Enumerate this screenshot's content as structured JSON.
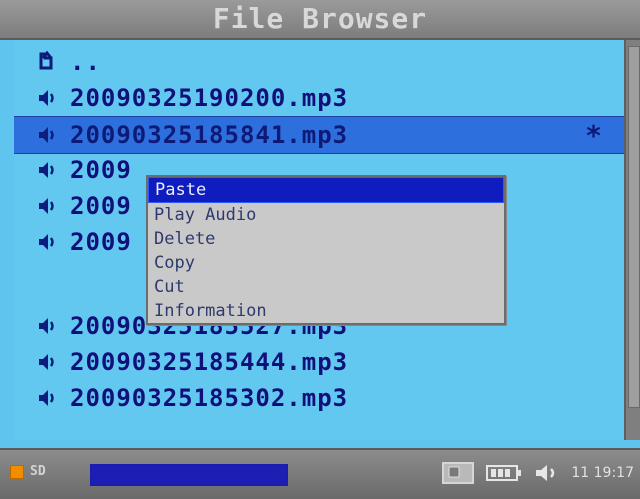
{
  "title": "File Browser",
  "file_list": [
    {
      "name": "..",
      "icon": "folder-up-icon"
    },
    {
      "name": "20090325190200.mp3",
      "icon": "speaker-icon"
    },
    {
      "name": "20090325185841.mp3",
      "icon": "speaker-icon",
      "selected": true,
      "mark": "*"
    },
    {
      "name": "2009",
      "icon": "speaker-icon"
    },
    {
      "name": "2009",
      "icon": "speaker-icon"
    },
    {
      "name": "2009",
      "icon": "speaker-icon"
    },
    {
      "name": "20090325185527.mp3",
      "icon": "speaker-icon"
    },
    {
      "name": "20090325185444.mp3",
      "icon": "speaker-icon"
    },
    {
      "name": "20090325185302.mp3",
      "icon": "speaker-icon"
    }
  ],
  "context_menu": {
    "items": [
      "Paste",
      "Play Audio",
      "Delete",
      "Copy",
      "Cut",
      "Information"
    ],
    "active_index": 0
  },
  "status_bar": {
    "storage_label": "SD",
    "progress_fraction": 1.0,
    "clock": "11 19:17"
  },
  "colors": {
    "background": "#5fc4ee",
    "selected_row": "#2d6fdd",
    "menu_active": "#0f1dbf",
    "accent_orange": "#f28c00"
  }
}
